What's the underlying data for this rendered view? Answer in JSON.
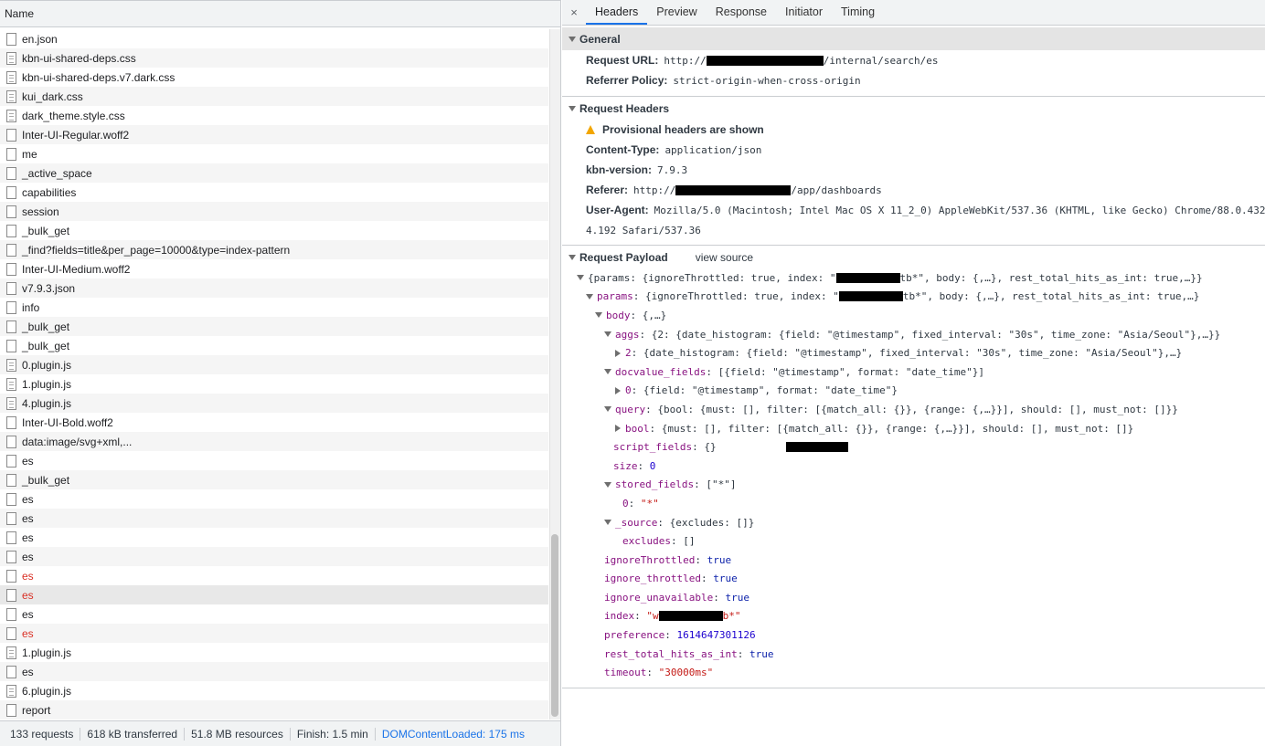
{
  "left": {
    "header": "Name",
    "requests": [
      {
        "name": "en.json",
        "icon": "doc",
        "error": false
      },
      {
        "name": "kbn-ui-shared-deps.css",
        "icon": "lines",
        "error": false
      },
      {
        "name": "kbn-ui-shared-deps.v7.dark.css",
        "icon": "lines",
        "error": false
      },
      {
        "name": "kui_dark.css",
        "icon": "lines",
        "error": false
      },
      {
        "name": "dark_theme.style.css",
        "icon": "lines",
        "error": false
      },
      {
        "name": "Inter-UI-Regular.woff2",
        "icon": "doc",
        "error": false
      },
      {
        "name": "me",
        "icon": "doc",
        "error": false
      },
      {
        "name": "_active_space",
        "icon": "doc",
        "error": false
      },
      {
        "name": "capabilities",
        "icon": "doc",
        "error": false
      },
      {
        "name": "session",
        "icon": "doc",
        "error": false
      },
      {
        "name": "_bulk_get",
        "icon": "doc",
        "error": false
      },
      {
        "name": "_find?fields=title&per_page=10000&type=index-pattern",
        "icon": "doc",
        "error": false
      },
      {
        "name": "Inter-UI-Medium.woff2",
        "icon": "doc",
        "error": false
      },
      {
        "name": "v7.9.3.json",
        "icon": "doc",
        "error": false
      },
      {
        "name": "info",
        "icon": "doc",
        "error": false
      },
      {
        "name": "_bulk_get",
        "icon": "doc",
        "error": false
      },
      {
        "name": "_bulk_get",
        "icon": "doc",
        "error": false
      },
      {
        "name": "0.plugin.js",
        "icon": "lines",
        "error": false
      },
      {
        "name": "1.plugin.js",
        "icon": "lines",
        "error": false
      },
      {
        "name": "4.plugin.js",
        "icon": "lines",
        "error": false
      },
      {
        "name": "Inter-UI-Bold.woff2",
        "icon": "doc",
        "error": false
      },
      {
        "name": "data:image/svg+xml,...",
        "icon": "doc",
        "error": false
      },
      {
        "name": "es",
        "icon": "doc",
        "error": false
      },
      {
        "name": "_bulk_get",
        "icon": "doc",
        "error": false
      },
      {
        "name": "es",
        "icon": "doc",
        "error": false
      },
      {
        "name": "es",
        "icon": "doc",
        "error": false
      },
      {
        "name": "es",
        "icon": "doc",
        "error": false
      },
      {
        "name": "es",
        "icon": "doc",
        "error": false
      },
      {
        "name": "es",
        "icon": "doc",
        "error": true
      },
      {
        "name": "es",
        "icon": "doc",
        "error": true,
        "selected": true
      },
      {
        "name": "es",
        "icon": "doc",
        "error": false
      },
      {
        "name": "es",
        "icon": "doc",
        "error": true
      },
      {
        "name": "1.plugin.js",
        "icon": "lines",
        "error": false
      },
      {
        "name": "es",
        "icon": "doc",
        "error": false
      },
      {
        "name": "6.plugin.js",
        "icon": "lines",
        "error": false
      },
      {
        "name": "report",
        "icon": "doc",
        "error": false
      }
    ],
    "status": {
      "requests": "133 requests",
      "transferred": "618 kB transferred",
      "resources": "51.8 MB resources",
      "finish": "Finish: 1.5 min",
      "dom": "DOMContentLoaded: 175 ms"
    }
  },
  "right": {
    "close": "×",
    "tabs": [
      "Headers",
      "Preview",
      "Response",
      "Initiator",
      "Timing"
    ],
    "general": {
      "title": "General",
      "url_label": "Request URL:",
      "url_prefix": "http://",
      "url_suffix": "/internal/search/es",
      "policy_label": "Referrer Policy:",
      "policy_value": "strict-origin-when-cross-origin"
    },
    "req_headers": {
      "title": "Request Headers",
      "warning": "Provisional headers are shown",
      "ct_label": "Content-Type:",
      "ct_value": "application/json",
      "kbn_label": "kbn-version:",
      "kbn_value": "7.9.3",
      "ref_label": "Referer:",
      "ref_prefix": "http://",
      "ref_suffix": "/app/dashboards",
      "ua_label": "User-Agent:",
      "ua_value": "Mozilla/5.0 (Macintosh; Intel Mac OS X 11_2_0) AppleWebKit/537.36 (KHTML, like Gecko) Chrome/88.0.432",
      "ua_value_2": "4.192 Safari/537.36"
    },
    "payload": {
      "title": "Request Payload",
      "view_source": "view source",
      "l1_a": "{params: {ignoreThrottled: true, index: \"",
      "l1_b": "tb*\", body: {,…}, rest_total_hits_as_int: true,…}}",
      "l2_key": "params",
      "l2_a": ": {ignoreThrottled: true, index: \"",
      "l2_b": "tb*\", body: {,…}, rest_total_hits_as_int: true,…}",
      "l3_key": "body",
      "l3_val": ": {,…}",
      "l4_key": "aggs",
      "l4_val": ": {2: {date_histogram: {field: \"@timestamp\", fixed_interval: \"30s\", time_zone: \"Asia/Seoul\"},…}}",
      "l5_key": "2",
      "l5_val": ": {date_histogram: {field: \"@timestamp\", fixed_interval: \"30s\", time_zone: \"Asia/Seoul\"},…}",
      "l6_key": "docvalue_fields",
      "l6_val": ": [{field: \"@timestamp\", format: \"date_time\"}]",
      "l7_key": "0",
      "l7_val": ": {field: \"@timestamp\", format: \"date_time\"}",
      "l8_key": "query",
      "l8_val": ": {bool: {must: [], filter: [{match_all: {}}, {range: {,…}}], should: [], must_not: []}}",
      "l9_key": "bool",
      "l9_val": ": {must: [], filter: [{match_all: {}}, {range: {,…}}], should: [], must_not: []}",
      "l10_key": "script_fields",
      "l10_val": ": {}",
      "l11_key": "size",
      "l11_val": "0",
      "l12_key": "stored_fields",
      "l12_val": ": [\"*\"]",
      "l13_key": "0",
      "l13_val": "\"*\"",
      "l14_key": "_source",
      "l14_val": ": {excludes: []}",
      "l15_key": "excludes",
      "l15_val": ": []",
      "l16_key": "ignoreThrottled",
      "l16_val": "true",
      "l17_key": "ignore_throttled",
      "l17_val": "true",
      "l18_key": "ignore_unavailable",
      "l18_val": "true",
      "l19_key": "index",
      "l19_a": "\"w",
      "l19_b": "b*\"",
      "l20_key": "preference",
      "l20_val": "1614647301126",
      "l21_key": "rest_total_hits_as_int",
      "l21_val": "true",
      "l22_key": "timeout",
      "l22_val": "\"30000ms\""
    }
  }
}
